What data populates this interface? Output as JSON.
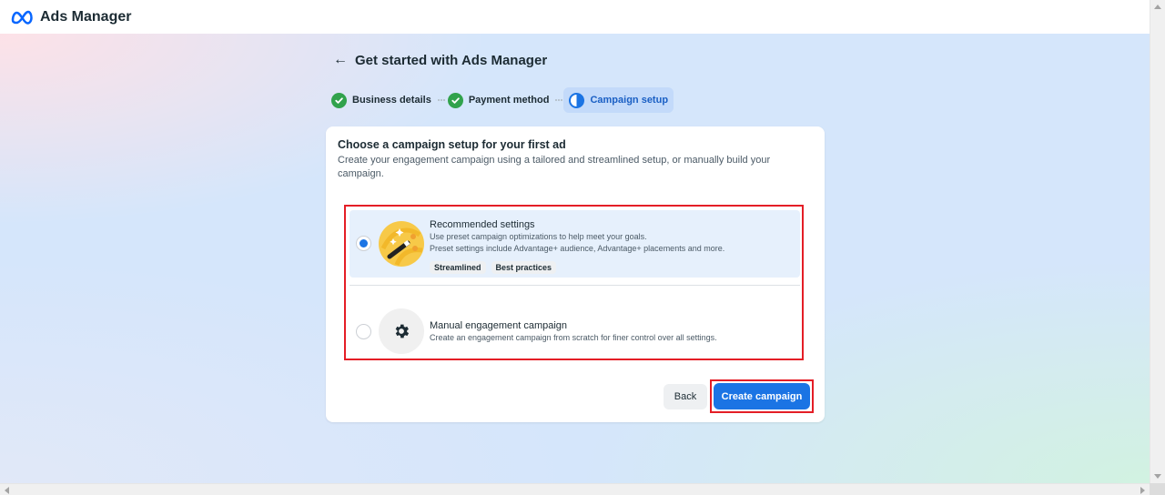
{
  "app": {
    "title": "Ads Manager",
    "logo_icon": "meta-logo-icon"
  },
  "header": {
    "back_icon": "←",
    "title": "Get started with Ads Manager"
  },
  "stepper": {
    "steps": [
      {
        "label": "Business details",
        "status": "complete",
        "icon": "check-circle-icon"
      },
      {
        "label": "Payment method",
        "status": "complete",
        "icon": "check-circle-icon"
      },
      {
        "label": "Campaign setup",
        "status": "active",
        "icon": "half-circle-icon"
      }
    ]
  },
  "card": {
    "title": "Choose a campaign setup for your first ad",
    "description": "Create your engagement campaign using a tailored and streamlined setup, or manually build your campaign.",
    "options": [
      {
        "title": "Recommended settings",
        "lines": [
          "Use preset campaign optimizations to help meet your goals.",
          "Preset settings include Advantage+ audience, Advantage+ placements and more."
        ],
        "tags": [
          "Streamlined",
          "Best practices"
        ],
        "selected": true,
        "icon": "magic-wand-icon"
      },
      {
        "title": "Manual engagement campaign",
        "lines": [
          "Create an engagement campaign from scratch for finer control over all settings."
        ],
        "selected": false,
        "icon": "gear-icon"
      }
    ],
    "buttons": {
      "back": "Back",
      "create": "Create campaign"
    }
  },
  "colors": {
    "primary": "#1b74e4",
    "success": "#31a24c",
    "highlight_border": "#e41e26",
    "selected_bg": "#e6f0fc"
  }
}
